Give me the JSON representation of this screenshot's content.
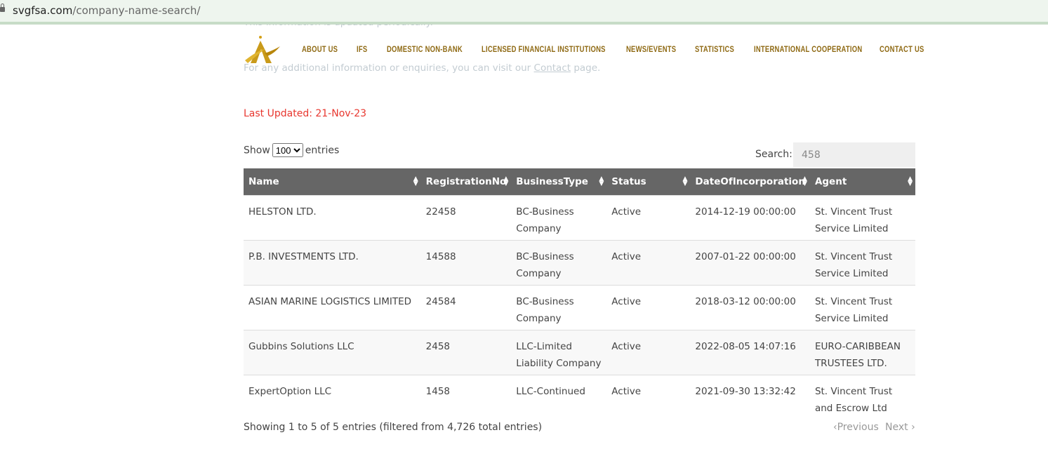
{
  "browser": {
    "url_host": "svgfsa.com",
    "url_path": "/company-name-search/"
  },
  "page": {
    "faded_top": "This information is updated periodically.",
    "faded_contact_pre": "For any additional information or enquiries, you can visit our ",
    "contact_link": "Contact",
    "faded_contact_post": " page.",
    "last_updated": "Last Updated:  21-Nov-23"
  },
  "nav": [
    "ABOUT US",
    "IFS",
    "DOMESTIC NON-BANK",
    "LICENSED FINANCIAL INSTITUTIONS",
    "NEWS/EVENTS",
    "STATISTICS",
    "INTERNATIONAL COOPERATION",
    "CONTACT US"
  ],
  "table_controls": {
    "show_label": "Show",
    "entries_label": "entries",
    "page_length": "100",
    "search_label": "Search:",
    "search_value": "458"
  },
  "columns": [
    "Name",
    "RegistrationNo",
    "BusinessType",
    "Status",
    "DateOfIncorporation",
    "Agent"
  ],
  "rows": [
    [
      "HELSTON LTD.",
      "22458",
      "BC-Business Company",
      "Active",
      "2014-12-19 00:00:00",
      "St. Vincent Trust Service Limited"
    ],
    [
      "P.B. INVESTMENTS LTD.",
      "14588",
      "BC-Business Company",
      "Active",
      "2007-01-22 00:00:00",
      "St. Vincent Trust Service Limited"
    ],
    [
      "ASIAN MARINE LOGISTICS LIMITED",
      "24584",
      "BC-Business Company",
      "Active",
      "2018-03-12 00:00:00",
      "St. Vincent Trust Service Limited"
    ],
    [
      "Gubbins Solutions LLC",
      "2458",
      "LLC-Limited Liability Company",
      "Active",
      "2022-08-05 14:07:16",
      "EURO-CARIBBEAN TRUSTEES LTD."
    ],
    [
      "ExpertOption LLC",
      "1458",
      "LLC-Continued",
      "Active",
      "2021-09-30 13:32:42",
      "St. Vincent Trust and Escrow Ltd"
    ]
  ],
  "footer": {
    "info": "Showing 1 to 5 of 5 entries (filtered from 4,726 total entries)",
    "previous": "Previous",
    "next": "Next"
  },
  "colors": {
    "accent": "#8f6a14",
    "header_bg": "#666666",
    "updated": "#e8372f"
  }
}
